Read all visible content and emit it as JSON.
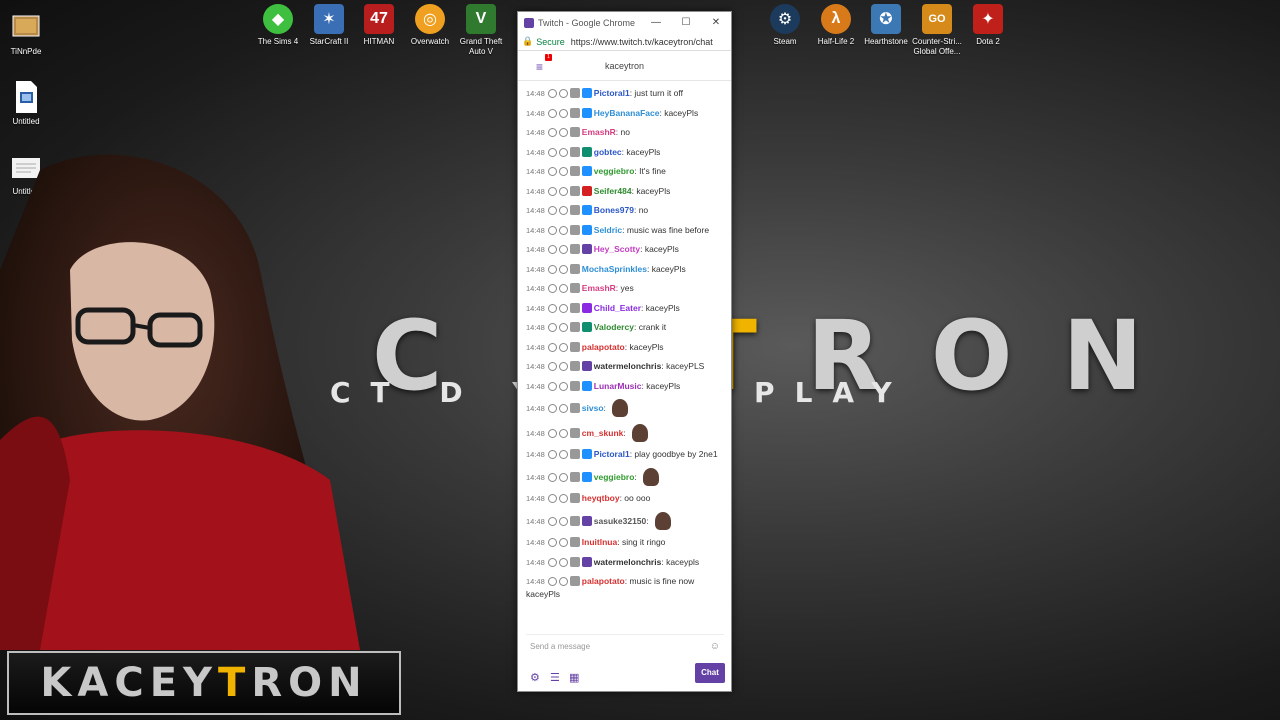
{
  "wallpaper": {
    "title_a": "C",
    "title_b": "E",
    "title_accent": "T",
    "title_c": "RON",
    "subtitle": "CT    D      Y    GAMEPLAY"
  },
  "desktop_left": [
    {
      "label": "TiNnPde"
    },
    {
      "label": "Untitled"
    },
    {
      "label": "Untitled"
    }
  ],
  "desktop_top": [
    {
      "label": "The Sims 4",
      "glyph": "◆",
      "color": "#3fbf3f"
    },
    {
      "label": "StarCraft II",
      "glyph": "✶",
      "color": "#3b6fb5"
    },
    {
      "label": "HITMAN",
      "glyph": "47",
      "color": "#b81e1e"
    },
    {
      "label": "Overwatch",
      "glyph": "◎",
      "color": "#f0a020"
    },
    {
      "label": "Grand Theft\nAuto V",
      "glyph": "V",
      "color": "#2f7a2f"
    },
    {
      "label": "Steam",
      "glyph": "⚙",
      "color": "#1b3a5c"
    },
    {
      "label": "Half-Life 2",
      "glyph": "λ",
      "color": "#d97a1a"
    },
    {
      "label": "Hearthstone",
      "glyph": "✪",
      "color": "#3c78b4"
    },
    {
      "label": "Counter-Stri...\nGlobal Offe...",
      "glyph": "GO",
      "color": "#d58a1a"
    },
    {
      "label": "Dota 2",
      "glyph": "✦",
      "color": "#c0201a"
    }
  ],
  "browser": {
    "tab_title": "Twitch - Google Chrome",
    "secure_label": "Secure",
    "url": "https://www.twitch.tv/kaceytron/chat",
    "badge_count": "1",
    "channel_name": "kaceytron"
  },
  "chat": {
    "messages": [
      {
        "time": "14:48",
        "user": "Pictoral1",
        "color": "#2a56c6",
        "badge": "#1e90ff",
        "text": "just turn it off"
      },
      {
        "time": "14:48",
        "user": "HeyBananaFace",
        "color": "#2e8fd6",
        "badge": "#1e90ff",
        "text": "kaceyPls"
      },
      {
        "time": "14:48",
        "user": "EmashR",
        "color": "#d63c80",
        "badge": "",
        "text": "no"
      },
      {
        "time": "14:48",
        "user": "gobtec",
        "color": "#2a56c6",
        "badge": "#0f8f6f",
        "text": "kaceyPls"
      },
      {
        "time": "14:48",
        "user": "veggiebro",
        "color": "#2f9a2f",
        "badge": "#1e90ff",
        "text": "It's fine"
      },
      {
        "time": "14:48",
        "user": "Seifer484",
        "color": "#2f8a2f",
        "badge": "#d42020",
        "text": "kaceyPls"
      },
      {
        "time": "14:48",
        "user": "Bones979",
        "color": "#2a56c6",
        "badge": "#1e90ff",
        "text": "no"
      },
      {
        "time": "14:48",
        "user": "Seldric",
        "color": "#2e8fd6",
        "badge": "#1e90ff",
        "text": "music was fine before"
      },
      {
        "time": "14:48",
        "user": "Hey_Scotty",
        "color": "#c23cc2",
        "badge": "#6441a5",
        "text": "kaceyPls"
      },
      {
        "time": "14:48",
        "user": "MochaSprinkles",
        "color": "#2e8fd6",
        "badge": "",
        "text": "kaceyPls"
      },
      {
        "time": "14:48",
        "user": "EmashR",
        "color": "#d63c80",
        "badge": "",
        "text": "yes"
      },
      {
        "time": "14:48",
        "user": "Child_Eater",
        "color": "#8a2be2",
        "badge": "#8a2be2",
        "text": "kaceyPls"
      },
      {
        "time": "14:48",
        "user": "Valodercy",
        "color": "#2f8a2f",
        "badge": "#0f8f6f",
        "text": "crank it"
      },
      {
        "time": "14:48",
        "user": "palapotato",
        "color": "#d63030",
        "badge": "",
        "text": "kaceyPls"
      },
      {
        "time": "14:48",
        "user": "watermelonchris",
        "color": "#333333",
        "badge": "#6441a5",
        "text": "kaceyPLS"
      },
      {
        "time": "14:48",
        "user": "LunarMusic",
        "color": "#9b2fb5",
        "badge": "#1e90ff",
        "text": "kaceyPls"
      },
      {
        "time": "14:48",
        "user": "sivso",
        "color": "#2e8fd6",
        "badge": "",
        "text": "",
        "emote": true
      },
      {
        "time": "14:48",
        "user": "cm_skunk",
        "color": "#d63030",
        "badge": "",
        "text": "",
        "emote": true
      },
      {
        "time": "14:48",
        "user": "Pictoral1",
        "color": "#2a56c6",
        "badge": "#1e90ff",
        "text": "play goodbye by 2ne1"
      },
      {
        "time": "14:48",
        "user": "veggiebro",
        "color": "#2f9a2f",
        "badge": "#1e90ff",
        "text": "",
        "emote": true
      },
      {
        "time": "14:48",
        "user": "heyqtboy",
        "color": "#d63030",
        "badge": "",
        "text": "oo ooo"
      },
      {
        "time": "14:48",
        "user": "sasuke32150",
        "color": "#555555",
        "badge": "#6441a5",
        "text": "",
        "emote": true
      },
      {
        "time": "14:48",
        "user": "Inuitlnua",
        "color": "#d63030",
        "badge": "",
        "text": "sing it ringo"
      },
      {
        "time": "14:48",
        "user": "watermelonchris",
        "color": "#333333",
        "badge": "#6441a5",
        "text": "kaceypls"
      },
      {
        "time": "14:48",
        "user": "palapotato",
        "color": "#d63030",
        "badge": "",
        "text": "music is fine now kaceyPls"
      }
    ],
    "input_placeholder": "Send a message",
    "chat_button": "Chat"
  },
  "logo": {
    "a": "KACEY",
    "accent": "T",
    "b": "RON"
  }
}
